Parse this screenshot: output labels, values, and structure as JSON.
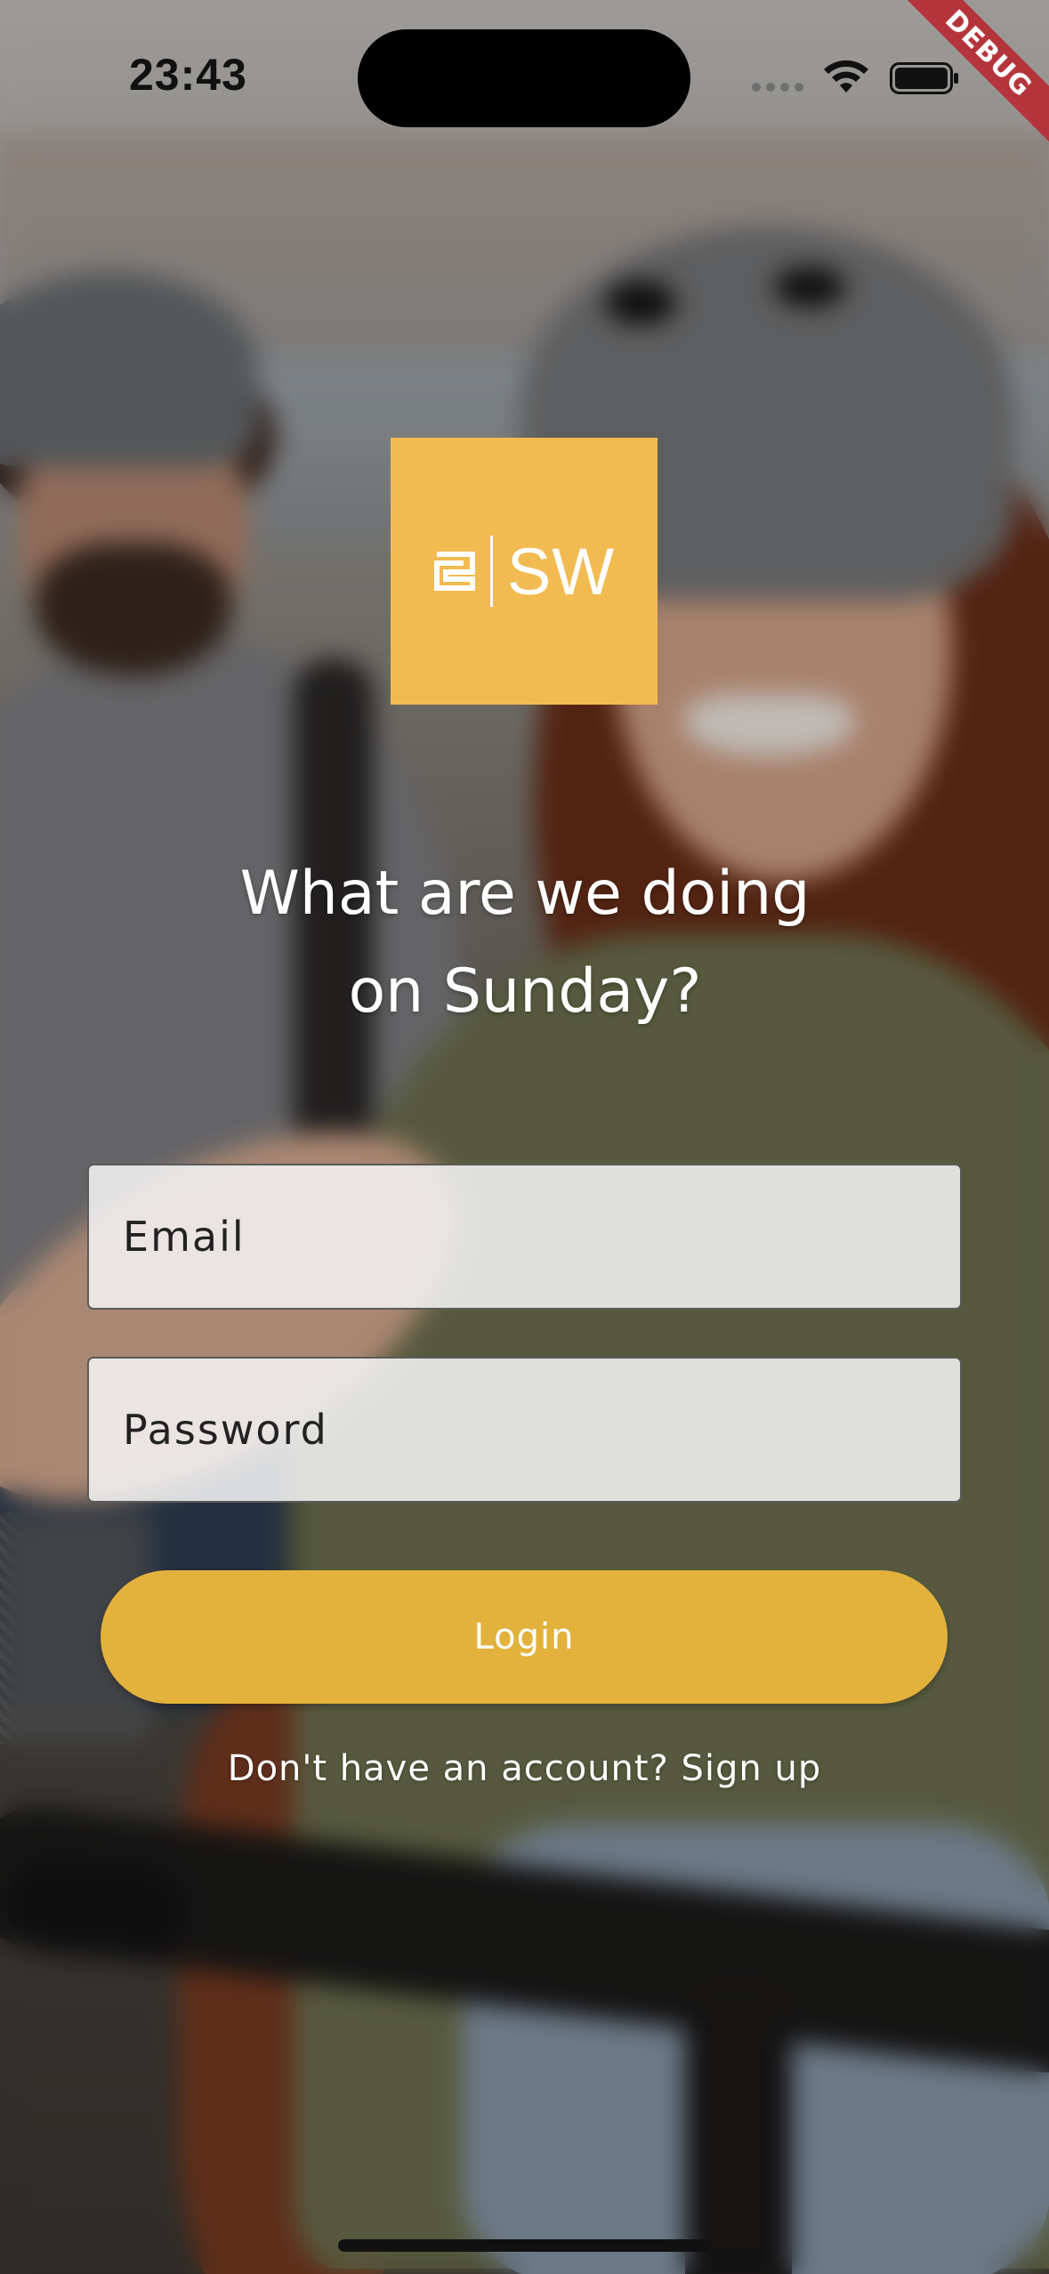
{
  "status_bar": {
    "time": "23:43"
  },
  "debug_banner": {
    "label": "DEBUG"
  },
  "logo": {
    "text": "SW"
  },
  "headline": {
    "line1": "What are we doing",
    "line2": "on Sunday?"
  },
  "form": {
    "email_placeholder": "Email",
    "password_placeholder": "Password",
    "login_label": "Login",
    "signup_text": "Don't have an account? Sign up"
  },
  "colors": {
    "accent": "#e3b23d",
    "logo_background": "#f1bb52",
    "debug_banner": "#b4343b"
  },
  "icons": [
    "signal-dots-icon",
    "wifi-icon",
    "battery-icon",
    "logo-mark-icon"
  ]
}
